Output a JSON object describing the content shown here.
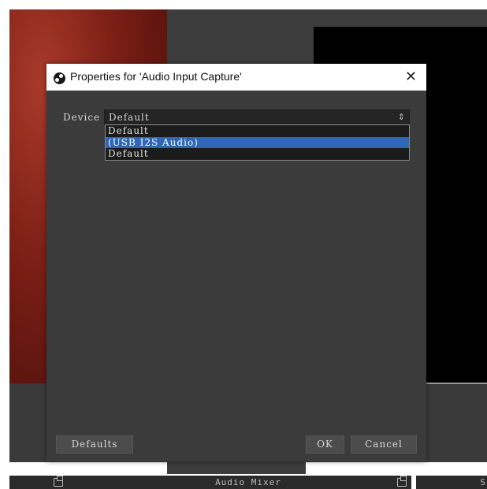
{
  "dialog": {
    "title": "Properties for 'Audio Input Capture'",
    "close_glyph": "✕",
    "device_label": "Device",
    "device_value": "Default",
    "combo_arrow_glyph": "⇕",
    "options": [
      "Default",
      "(USB I2S Audio)",
      "Default"
    ],
    "selected_index": 1,
    "defaults_label": "Defaults",
    "ok_label": "OK",
    "cancel_label": "Cancel"
  },
  "bottom_bar": {
    "audio_mixer_label": "Audio Mixer",
    "right_edge_label": "S"
  },
  "colors": {
    "selection": "#2f66b6",
    "dialog_bg": "#3b3b3b",
    "titlebar_bg": "#ffffff"
  },
  "icons": {
    "title_icon": "obs-logo-icon",
    "dock_icons": [
      "undock-icon",
      "undock-icon"
    ]
  }
}
